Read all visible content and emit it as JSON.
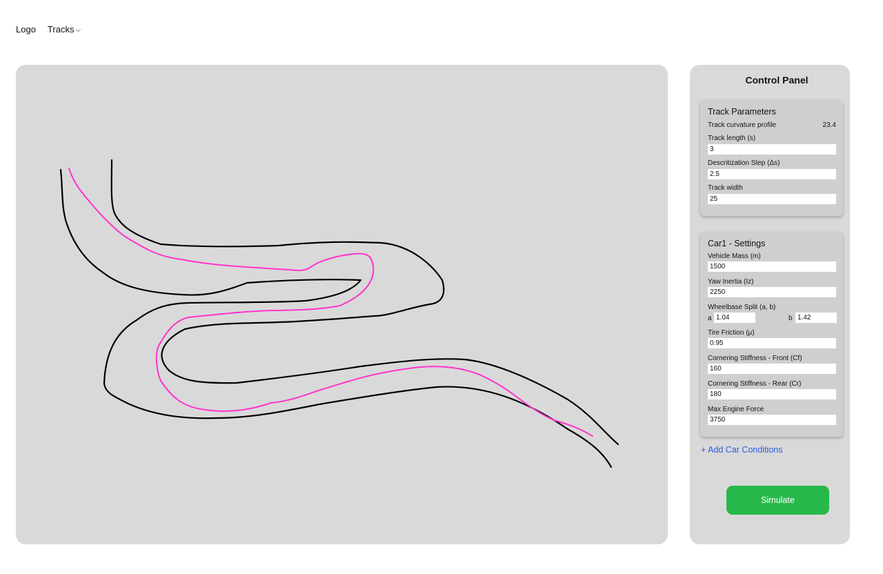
{
  "nav": {
    "logo": "Logo",
    "tracks": "Tracks",
    "tracks_chevron": "⌵"
  },
  "canvas": {
    "track_color": "#000000",
    "path_color": "#ff33cc"
  },
  "panel": {
    "title": "Control Panel",
    "track_params": {
      "heading": "Track Parameters",
      "curvature_label": "Track curvature profile",
      "curvature_value": "23.4",
      "length_label": "Track length (s)",
      "length_value": "3",
      "step_label": "Descritization Step (Δs)",
      "step_value": "2.5",
      "width_label": "Track width",
      "width_value": "25"
    },
    "car": {
      "heading": "Car1 - Settings",
      "mass_label": "Vehicle Mass (m)",
      "mass_value": "1500",
      "yaw_label": "Yaw Inertia (Iz)",
      "yaw_value": "2250",
      "wheelbase_label": "Wheelbase Split (a, b)",
      "a_label": "a",
      "a_value": "1.04",
      "b_label": "b",
      "b_value": "1.42",
      "friction_label": "Tire Friction (μ)",
      "friction_value": "0.95",
      "cf_label": "Cornering Stiffness - Front (Cf)",
      "cf_value": "160",
      "cr_label": "Cornering Stiffness - Rear (Cr)",
      "cr_value": "180",
      "force_label": "Max Engine Force",
      "force_value": "3750"
    },
    "add_link": "+ Add Car Conditions",
    "simulate": "Simulate"
  },
  "accent_colors": {
    "simulate_button": "#27b84a",
    "link": "#2f5be0"
  }
}
